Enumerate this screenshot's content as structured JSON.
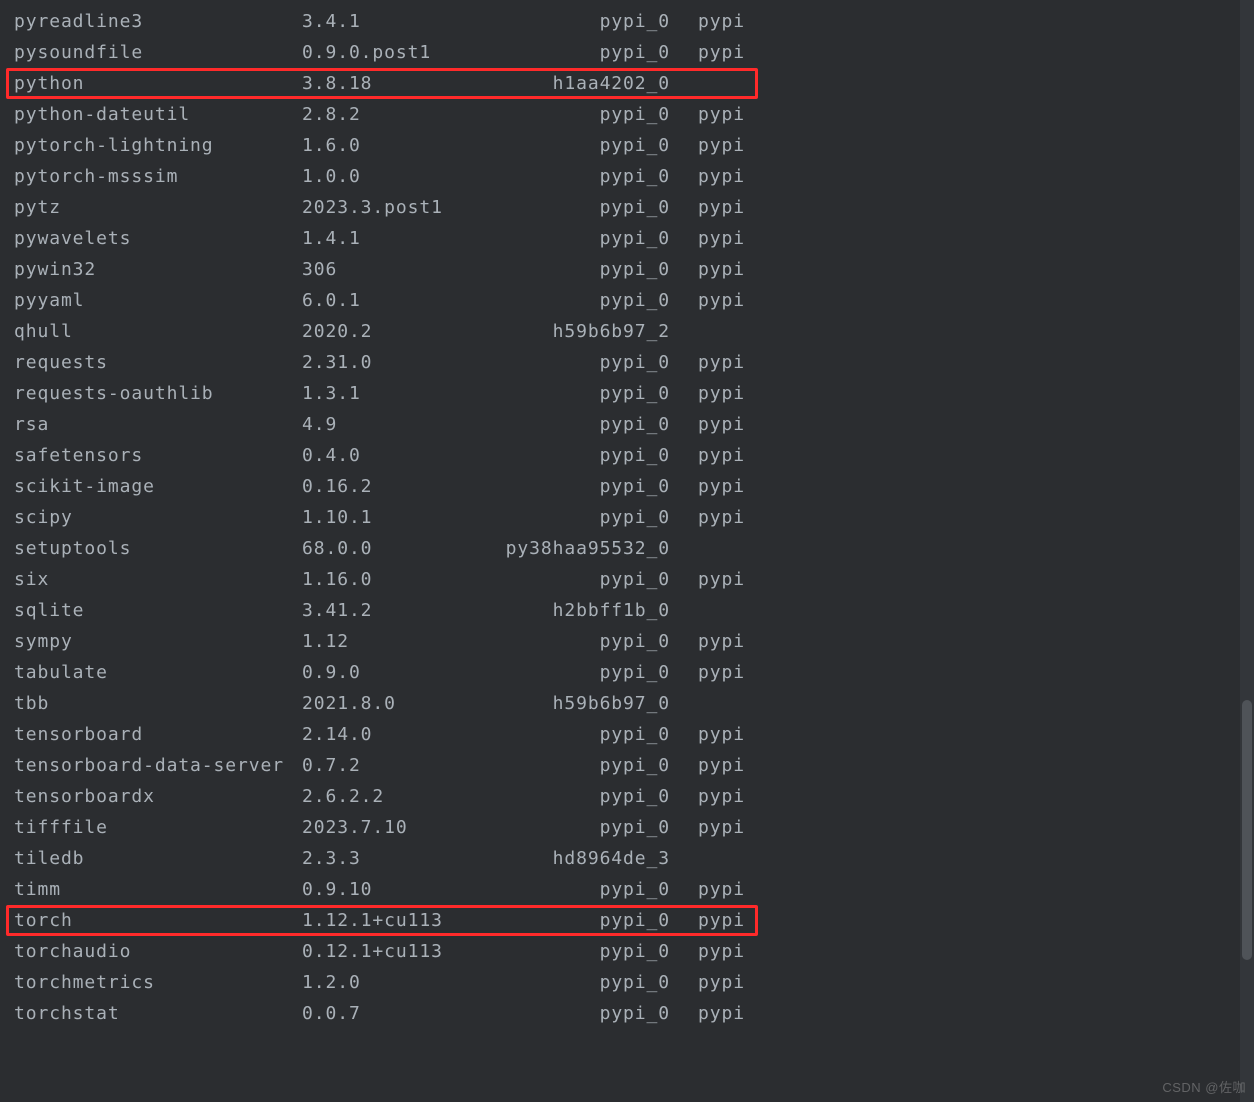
{
  "watermark": "CSDN @佐咖",
  "highlighted_indices": [
    2,
    29
  ],
  "packages": [
    {
      "name": "pyreadline3",
      "version": "3.4.1",
      "build": "pypi_0",
      "channel": "pypi"
    },
    {
      "name": "pysoundfile",
      "version": "0.9.0.post1",
      "build": "pypi_0",
      "channel": "pypi"
    },
    {
      "name": "python",
      "version": "3.8.18",
      "build": "h1aa4202_0",
      "channel": ""
    },
    {
      "name": "python-dateutil",
      "version": "2.8.2",
      "build": "pypi_0",
      "channel": "pypi"
    },
    {
      "name": "pytorch-lightning",
      "version": "1.6.0",
      "build": "pypi_0",
      "channel": "pypi"
    },
    {
      "name": "pytorch-msssim",
      "version": "1.0.0",
      "build": "pypi_0",
      "channel": "pypi"
    },
    {
      "name": "pytz",
      "version": "2023.3.post1",
      "build": "pypi_0",
      "channel": "pypi"
    },
    {
      "name": "pywavelets",
      "version": "1.4.1",
      "build": "pypi_0",
      "channel": "pypi"
    },
    {
      "name": "pywin32",
      "version": "306",
      "build": "pypi_0",
      "channel": "pypi"
    },
    {
      "name": "pyyaml",
      "version": "6.0.1",
      "build": "pypi_0",
      "channel": "pypi"
    },
    {
      "name": "qhull",
      "version": "2020.2",
      "build": "h59b6b97_2",
      "channel": ""
    },
    {
      "name": "requests",
      "version": "2.31.0",
      "build": "pypi_0",
      "channel": "pypi"
    },
    {
      "name": "requests-oauthlib",
      "version": "1.3.1",
      "build": "pypi_0",
      "channel": "pypi"
    },
    {
      "name": "rsa",
      "version": "4.9",
      "build": "pypi_0",
      "channel": "pypi"
    },
    {
      "name": "safetensors",
      "version": "0.4.0",
      "build": "pypi_0",
      "channel": "pypi"
    },
    {
      "name": "scikit-image",
      "version": "0.16.2",
      "build": "pypi_0",
      "channel": "pypi"
    },
    {
      "name": "scipy",
      "version": "1.10.1",
      "build": "pypi_0",
      "channel": "pypi"
    },
    {
      "name": "setuptools",
      "version": "68.0.0",
      "build": "py38haa95532_0",
      "channel": ""
    },
    {
      "name": "six",
      "version": "1.16.0",
      "build": "pypi_0",
      "channel": "pypi"
    },
    {
      "name": "sqlite",
      "version": "3.41.2",
      "build": "h2bbff1b_0",
      "channel": ""
    },
    {
      "name": "sympy",
      "version": "1.12",
      "build": "pypi_0",
      "channel": "pypi"
    },
    {
      "name": "tabulate",
      "version": "0.9.0",
      "build": "pypi_0",
      "channel": "pypi"
    },
    {
      "name": "tbb",
      "version": "2021.8.0",
      "build": "h59b6b97_0",
      "channel": ""
    },
    {
      "name": "tensorboard",
      "version": "2.14.0",
      "build": "pypi_0",
      "channel": "pypi"
    },
    {
      "name": "tensorboard-data-server",
      "version": "0.7.2",
      "build": "pypi_0",
      "channel": "pypi"
    },
    {
      "name": "tensorboardx",
      "version": "2.6.2.2",
      "build": "pypi_0",
      "channel": "pypi"
    },
    {
      "name": "tifffile",
      "version": "2023.7.10",
      "build": "pypi_0",
      "channel": "pypi"
    },
    {
      "name": "tiledb",
      "version": "2.3.3",
      "build": "hd8964de_3",
      "channel": ""
    },
    {
      "name": "timm",
      "version": "0.9.10",
      "build": "pypi_0",
      "channel": "pypi"
    },
    {
      "name": "torch",
      "version": "1.12.1+cu113",
      "build": "pypi_0",
      "channel": "pypi"
    },
    {
      "name": "torchaudio",
      "version": "0.12.1+cu113",
      "build": "pypi_0",
      "channel": "pypi"
    },
    {
      "name": "torchmetrics",
      "version": "1.2.0",
      "build": "pypi_0",
      "channel": "pypi"
    },
    {
      "name": "torchstat",
      "version": "0.0.7",
      "build": "pypi_0",
      "channel": "pypi"
    }
  ]
}
